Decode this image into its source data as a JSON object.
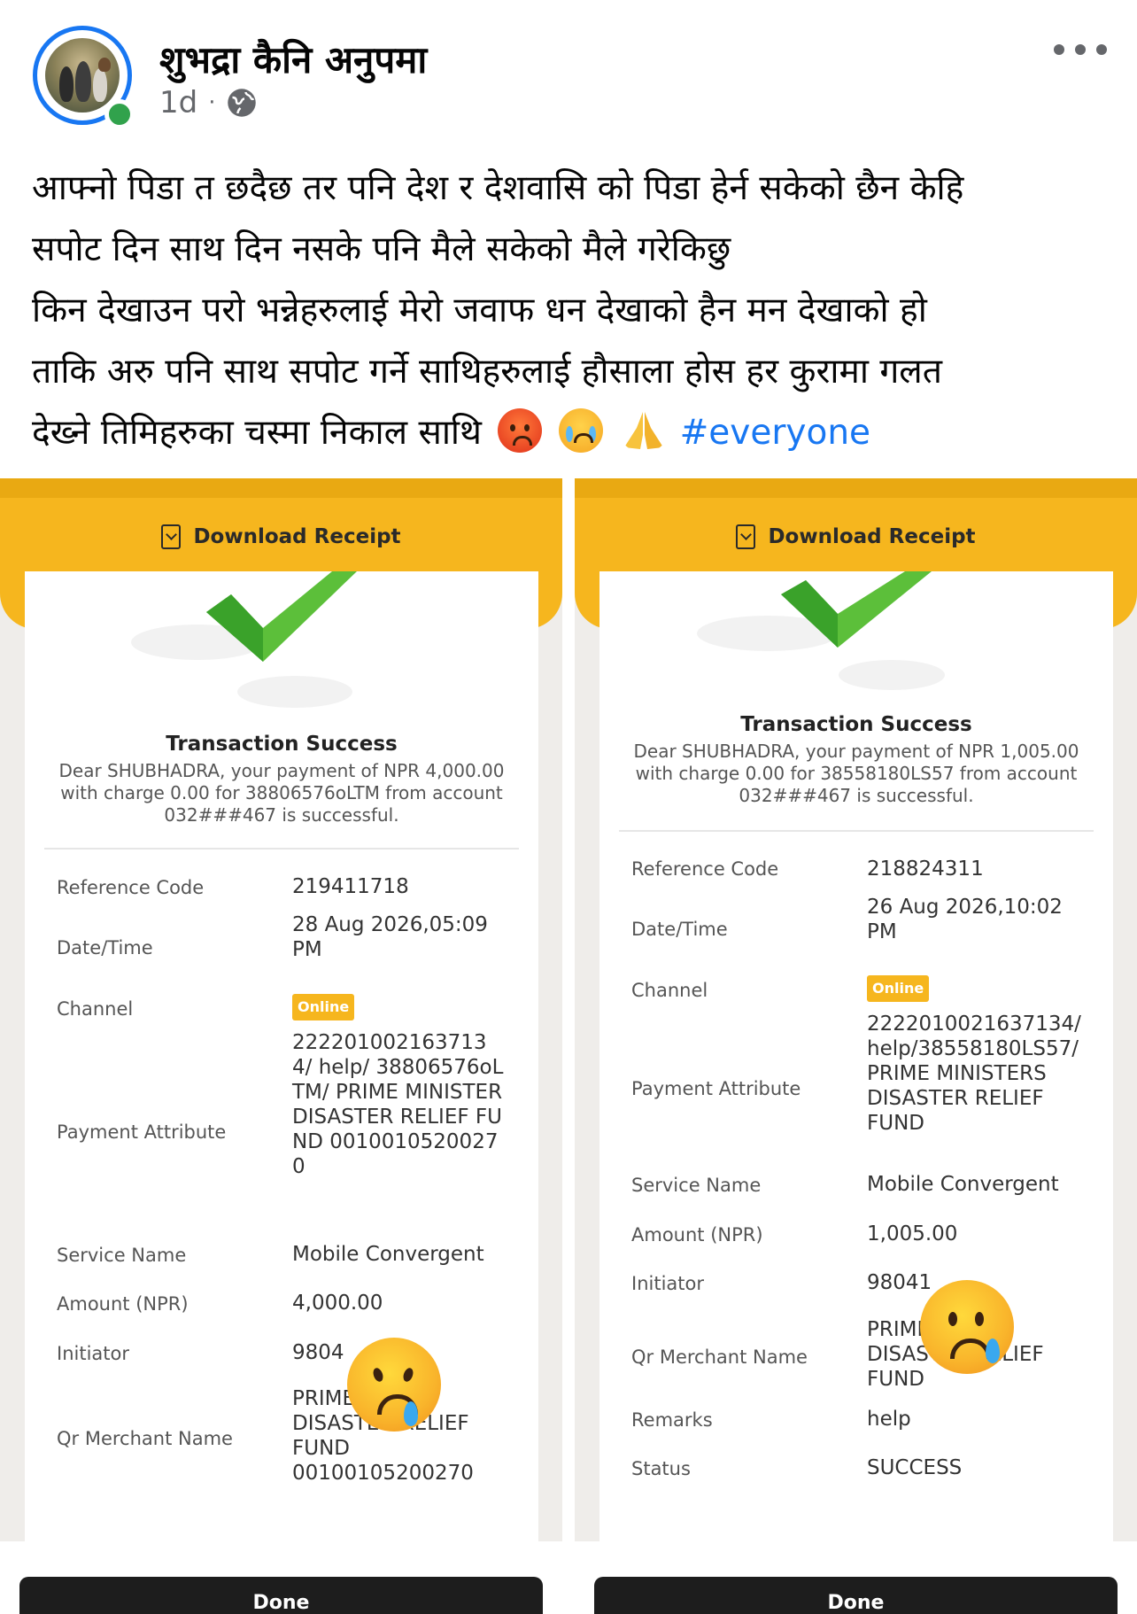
{
  "post": {
    "author": "शुभद्रा कैनि अनुपमा",
    "time": "1d",
    "separator": "·",
    "lines": [
      "आफ्नो पिडा त छदैछ तर पनि देश र देशवासि को पिडा हेर्न सकेको छैन केहि",
      "सपोट दिन साथ दिन नसके पनि मैले सकेको मैले गरेकिछु",
      "किन देखाउन परो भन्नेहरुलाई मेरो जवाफ धन देखाको हैन मन देखाको हो",
      "ताकि अरु पनि साथ सपोट गर्ने साथिहरुलाई हौसाला होस  हर कुरामा गलत",
      "देख्ने तिमिहरुका चस्मा निकाल साथि"
    ],
    "emojis": [
      "angry-face",
      "loudly-crying-face",
      "folded-hands"
    ],
    "hashtag": "#everyone"
  },
  "receipts": [
    {
      "download_label": "Download Receipt",
      "title": "Transaction Success",
      "message": "Dear SHUBHADRA, your payment of NPR 4,000.00 with charge 0.00 for 38806576oLTM from account 032###467 is successful.",
      "rows": [
        {
          "label": "Reference Code",
          "value": "219411718"
        },
        {
          "label": "Date/Time",
          "value": "28 Aug 2026,05:09 PM"
        },
        {
          "label": "Channel",
          "value": "Online"
        },
        {
          "label": "Payment Attribute",
          "value": "2222010021637134/ help/ 38806576oLTM/ PRIME MINISTER DISASTER RELIEF FUND 00100105200270"
        },
        {
          "label": "Service Name",
          "value": "Mobile Convergent"
        },
        {
          "label": "Amount (NPR)",
          "value": "4,000.00"
        },
        {
          "label": "Initiator",
          "value": "9804"
        },
        {
          "label": "Qr Merchant Name",
          "value": "PRIME MI   TER DISASTER RELIEF FUND 00100105200270"
        }
      ],
      "done_label": "Done"
    },
    {
      "download_label": "Download Receipt",
      "title": "Transaction Success",
      "message": "Dear SHUBHADRA, your payment of NPR 1,005.00 with charge 0.00 for 38558180LS57 from account 032###467 is successful.",
      "rows": [
        {
          "label": "Reference Code",
          "value": "218824311"
        },
        {
          "label": "Date/Time",
          "value": "26 Aug 2026,10:02 PM"
        },
        {
          "label": "Channel",
          "value": "Online"
        },
        {
          "label": "Payment Attribute",
          "value": "2222010021637134/ help/38558180LS57/ PRIME MINISTERS DISASTER RELIEF FUND"
        },
        {
          "label": "Service Name",
          "value": "Mobile Convergent"
        },
        {
          "label": "Amount (NPR)",
          "value": "1,005.00"
        },
        {
          "label": "Initiator",
          "value": "98041"
        },
        {
          "label": "Qr Merchant Name",
          "value": "PRIME      ERS DISASTER RELIEF FUND"
        },
        {
          "label": "Remarks",
          "value": "help"
        },
        {
          "label": "Status",
          "value": "SUCCESS"
        }
      ],
      "done_label": "Done"
    }
  ],
  "colors": {
    "accent": "#1877f2",
    "online": "#31a24c",
    "receipt_yellow": "#f6b61e",
    "check_green": "#5cbf3a"
  }
}
